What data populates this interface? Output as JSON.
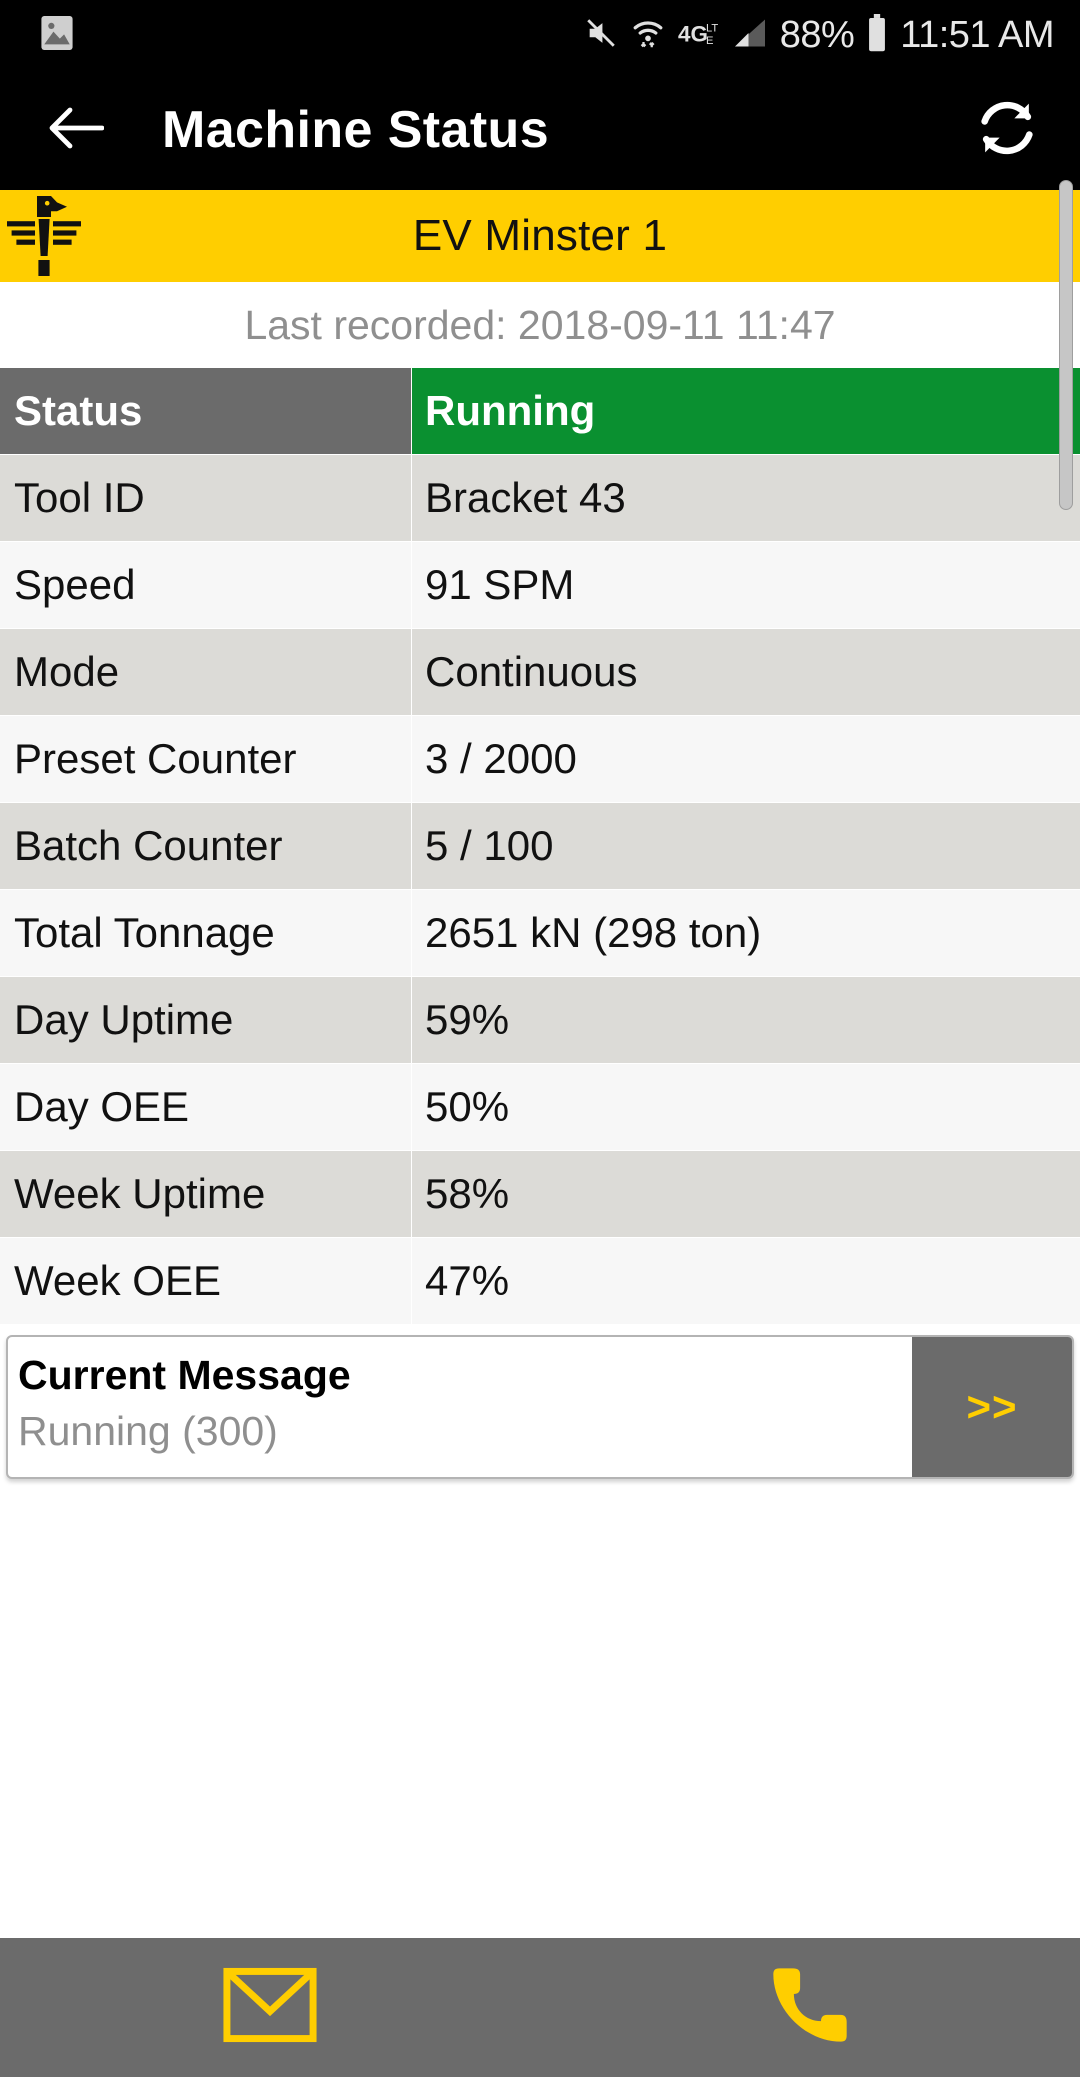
{
  "status_bar": {
    "left_icons": [
      {
        "name": "image-icon",
        "glyph": "image"
      }
    ],
    "right_icons": [
      {
        "name": "mute-icon",
        "glyph": "mute"
      },
      {
        "name": "wifi-icon",
        "glyph": "wifi"
      },
      {
        "name": "network-4g-lte-icon",
        "glyph": "4G"
      },
      {
        "name": "cellular-signal-icon",
        "glyph": "signal"
      },
      {
        "name": "battery-icon",
        "glyph": "battery"
      }
    ],
    "battery_percent": "88%",
    "clock": "11:51 AM"
  },
  "app_bar": {
    "back_icon": "arrow-left-icon",
    "title": "Machine Status",
    "refresh_icon": "refresh-icon"
  },
  "banner": {
    "logo_icon": "eagle-logo-icon",
    "machine_name": "EV Minster 1",
    "background_color": "#FFCE00"
  },
  "last_recorded": "Last recorded: 2018-09-11 11:47",
  "table": {
    "header": {
      "label": "Status",
      "value": "Running",
      "value_color": "#0a9030"
    },
    "rows": [
      {
        "label": "Tool ID",
        "value": "Bracket 43"
      },
      {
        "label": "Speed",
        "value": "91 SPM"
      },
      {
        "label": "Mode",
        "value": "Continuous"
      },
      {
        "label": "Preset Counter",
        "value": "3 / 2000"
      },
      {
        "label": "Batch Counter",
        "value": "5 / 100"
      },
      {
        "label": "Total Tonnage",
        "value": "2651 kN (298 ton)"
      },
      {
        "label": "Day Uptime",
        "value": "59%"
      },
      {
        "label": "Day OEE",
        "value": "50%"
      },
      {
        "label": "Week Uptime",
        "value": "58%"
      },
      {
        "label": "Week OEE",
        "value": "47%"
      }
    ]
  },
  "message_card": {
    "title": "Current Message",
    "subtitle": "Running (300)",
    "next_label": ">>",
    "next_icon": "double-chevron-right-icon"
  },
  "bottom_bar": {
    "buttons": [
      {
        "name": "email-button",
        "icon": "envelope-icon"
      },
      {
        "name": "call-button",
        "icon": "phone-icon"
      }
    ],
    "background_color": "#6b6b6b",
    "icon_color": "#FFCE00"
  }
}
